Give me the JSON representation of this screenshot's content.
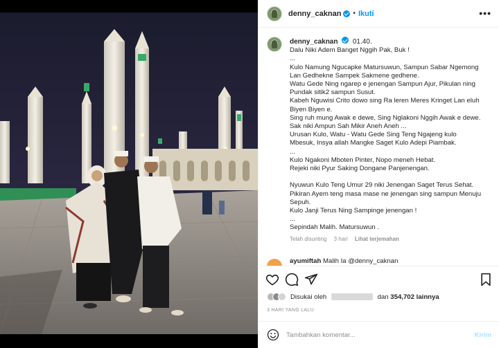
{
  "post": {
    "username": "denny_caknan",
    "follow_label": "Ikuti",
    "more_label": "•••"
  },
  "caption": {
    "username": "denny_caknan",
    "time": "01.40.",
    "lines": [
      "Dalu Niki Adem Banget Nggih Pak, Buk !",
      "...",
      "Kulo Namung Ngucapke Matursuwun, Sampun Sabar Ngemong",
      "Lan Gedhekne Sampek Sakmene gedhene.",
      "Watu Gede Ning ngarep e jenengan Sampun Ajur, Pikulan ning",
      "Pundak sitik2 sampun Susut.",
      "Kabeh Nguwisi Crito dowo sing Ra leren Meres Kringet Lan eluh",
      "Biyen Biyen e.",
      "Sing ruh mung Awak e dewe, Sing Nglakoni Nggih Awak e dewe.",
      "Sak niki Ampun Sah Mikir Aneh Aneh ...",
      "Urusan Kulo, Watu - Watu Gede Sing Teng Ngajeng kulo",
      "Mbesuk, Insya allah Mangke Saget Kulo Adepi Piambak.",
      "...",
      "Kulo Ngakoni Mboten Pinter, Nopo meneh Hebat.",
      "Rejeki niki Pyur Saking Dongane Panjenengan.",
      "",
      "Nyuwun Kulo Teng Umur 29 niki Jenengan Saget Terus Sehat.",
      "Pikiran Ayem teng masa mase ne jenengan sing sampun Menuju",
      "Sepuh.",
      "Kulo Janji Terus Ning Sampinge jenengan !",
      "...",
      "Sepindah Malih. Matursuwun ."
    ],
    "edited_label": "Telah disunting",
    "age": "3 hari",
    "see_translation": "Lihat terjemahan"
  },
  "next_comment": {
    "username": "ayumiftah",
    "text": "Malih Ia @denny_caknan"
  },
  "likes": {
    "prefix": "Disukai oleh",
    "middle": "dan",
    "count": "354,702",
    "suffix": "lainnya"
  },
  "date": "3 HARI YANG LALU",
  "comment_box": {
    "placeholder": "Tambahkan komentar...",
    "post_label": "Kirim"
  },
  "icons": {
    "like": "heart-icon",
    "comment": "comment-icon",
    "share": "paper-plane-icon",
    "save": "bookmark-icon",
    "emoji": "smiley-icon"
  },
  "colors": {
    "accent": "#0095f6",
    "text": "#262626",
    "muted": "#8e8e8e",
    "border": "#efefef",
    "post_disabled": "#b2dffc"
  }
}
